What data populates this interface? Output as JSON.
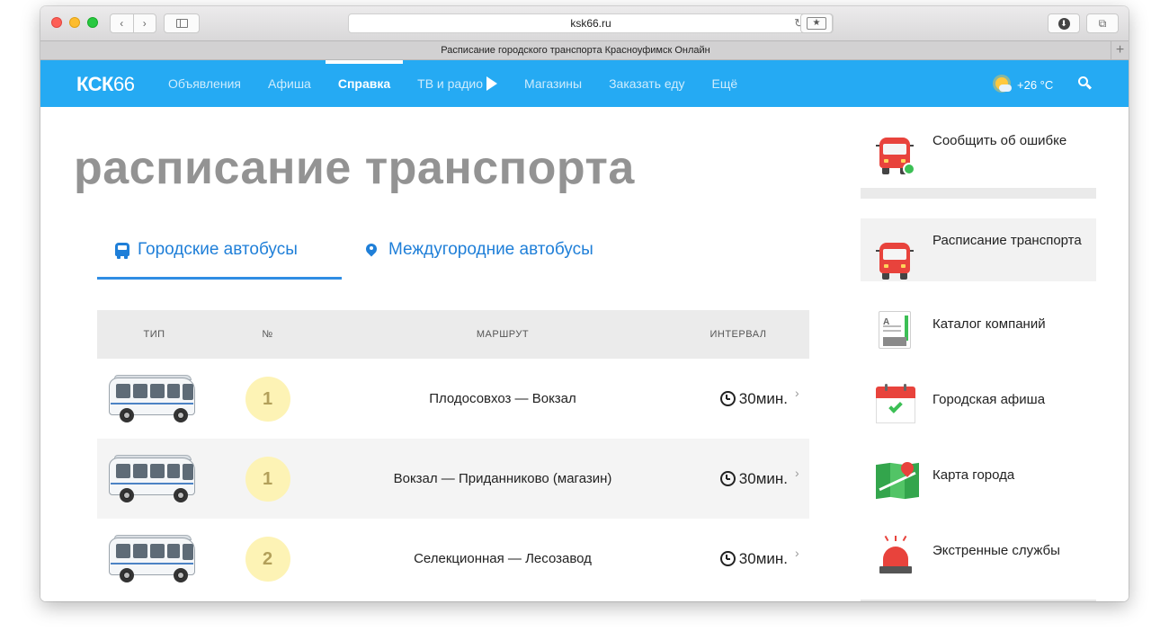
{
  "browser": {
    "url": "ksk66.ru",
    "tab_title": "Расписание городского транспорта Красноуфимск Онлайн",
    "nav_back": "‹",
    "nav_forward": "›",
    "reload_icon": "↻",
    "bookmark_icon": "★",
    "download_icon": "⬇",
    "tabs_icon": "⧉",
    "new_tab": "+"
  },
  "navbar": {
    "logo_bold": "КСК",
    "logo_thin": "66",
    "items": [
      {
        "label": "Объявления"
      },
      {
        "label": "Афиша"
      },
      {
        "label": "Справка"
      },
      {
        "label": "ТВ и радио"
      },
      {
        "label": "Магазины"
      },
      {
        "label": "Заказать еду"
      },
      {
        "label": "Ещё"
      }
    ],
    "active_item": "Справка",
    "weather": "+26 °C",
    "colors": {
      "bar": "#25aaf3",
      "sun": "#ffc83d"
    }
  },
  "main": {
    "title": "расписание транспорта",
    "tabs": [
      {
        "label": "Городские автобусы",
        "icon": "bus-icon",
        "active": true
      },
      {
        "label": "Междугородние автобусы",
        "icon": "map-pin-icon",
        "active": false
      }
    ],
    "table": {
      "headers": [
        "ТИП",
        "№",
        "МАРШРУТ",
        "ИНТЕРВАЛ"
      ],
      "rows": [
        {
          "number": "1",
          "route": "Плодосовхоз — Вокзал",
          "interval": "30мин."
        },
        {
          "number": "1",
          "route": "Вокзал — Приданниково (магазин)",
          "interval": "30мин."
        },
        {
          "number": "2",
          "route": "Селекционная — Лесозавод",
          "interval": "30мин."
        }
      ],
      "arrow": "›"
    },
    "colors": {
      "accent": "#1f7fd8",
      "badge": "#fdf3b5"
    }
  },
  "sidebar": {
    "report_error": "Сообщить об ошибке",
    "items": [
      {
        "label": "Расписание транспорта",
        "icon": "bus-icon",
        "active": true
      },
      {
        "label": "Каталог компаний",
        "icon": "catalog-icon"
      },
      {
        "label": "Городская афиша",
        "icon": "calendar-icon"
      },
      {
        "label": "Карта города",
        "icon": "map-icon"
      },
      {
        "label": "Экстренные службы",
        "icon": "siren-icon"
      }
    ],
    "catalog_icon_letter": "A"
  }
}
